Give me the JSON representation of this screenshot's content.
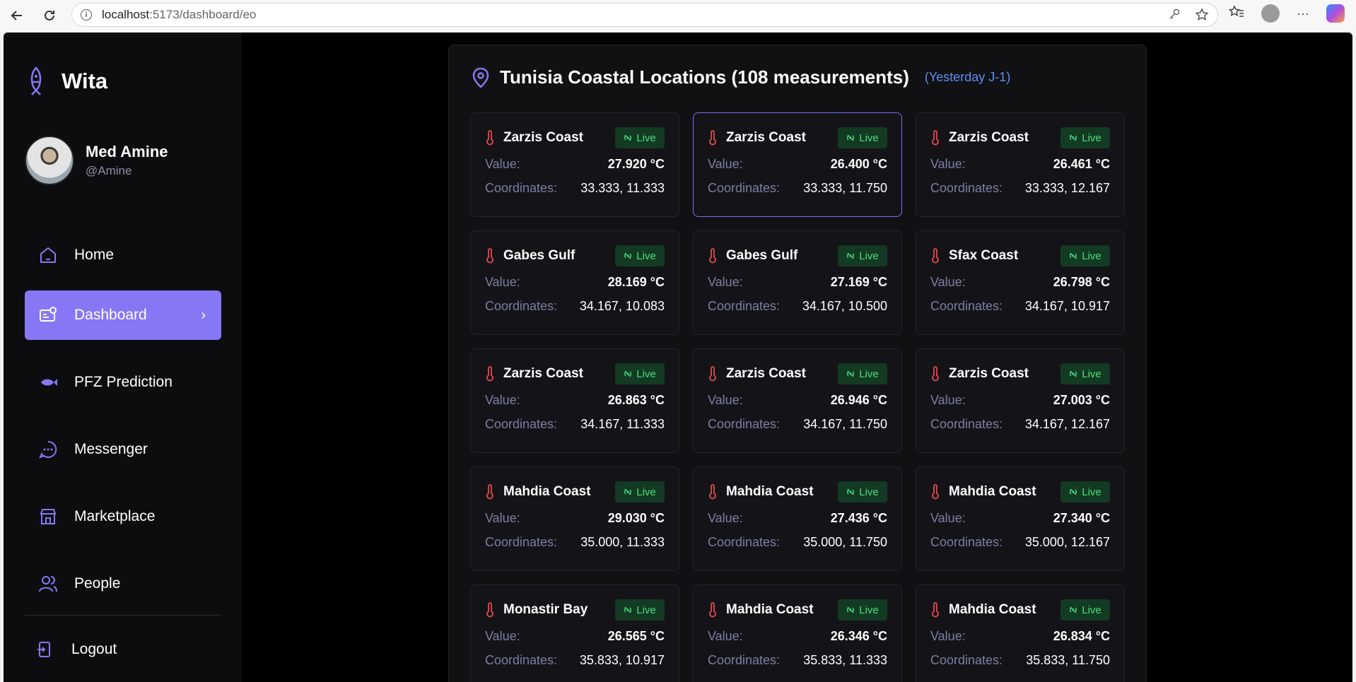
{
  "browser": {
    "url_host": "localhost",
    "url_path": ":5173/dashboard/eo"
  },
  "brand": {
    "name": "Wita"
  },
  "user": {
    "name": "Med Amine",
    "handle": "@Amine"
  },
  "menu": [
    {
      "label": "Home",
      "icon": "home-icon",
      "active": false
    },
    {
      "label": "Dashboard",
      "icon": "dashboard-icon",
      "active": true
    },
    {
      "label": "PFZ Prediction",
      "icon": "fish-icon",
      "active": false
    },
    {
      "label": "Messenger",
      "icon": "chat-icon",
      "active": false
    },
    {
      "label": "Marketplace",
      "icon": "store-icon",
      "active": false
    },
    {
      "label": "People",
      "icon": "people-icon",
      "active": false
    }
  ],
  "logout_label": "Logout",
  "panel": {
    "title": "Tunisia Coastal Locations (108 measurements)",
    "subtitle": "(Yesterday J-1)",
    "value_label": "Value:",
    "coords_label": "Coordinates:",
    "live_label": "Live"
  },
  "cards": [
    {
      "name": "Zarzis Coast",
      "value": "27.920 °C",
      "coords": "33.333, 11.333",
      "selected": false
    },
    {
      "name": "Zarzis Coast",
      "value": "26.400 °C",
      "coords": "33.333, 11.750",
      "selected": true
    },
    {
      "name": "Zarzis Coast",
      "value": "26.461 °C",
      "coords": "33.333, 12.167",
      "selected": false
    },
    {
      "name": "Gabes Gulf",
      "value": "28.169 °C",
      "coords": "34.167, 10.083",
      "selected": false
    },
    {
      "name": "Gabes Gulf",
      "value": "27.169 °C",
      "coords": "34.167, 10.500",
      "selected": false
    },
    {
      "name": "Sfax Coast",
      "value": "26.798 °C",
      "coords": "34.167, 10.917",
      "selected": false
    },
    {
      "name": "Zarzis Coast",
      "value": "26.863 °C",
      "coords": "34.167, 11.333",
      "selected": false
    },
    {
      "name": "Zarzis Coast",
      "value": "26.946 °C",
      "coords": "34.167, 11.750",
      "selected": false
    },
    {
      "name": "Zarzis Coast",
      "value": "27.003 °C",
      "coords": "34.167, 12.167",
      "selected": false
    },
    {
      "name": "Mahdia Coast",
      "value": "29.030 °C",
      "coords": "35.000, 11.333",
      "selected": false
    },
    {
      "name": "Mahdia Coast",
      "value": "27.436 °C",
      "coords": "35.000, 11.750",
      "selected": false
    },
    {
      "name": "Mahdia Coast",
      "value": "27.340 °C",
      "coords": "35.000, 12.167",
      "selected": false
    },
    {
      "name": "Monastir Bay",
      "value": "26.565 °C",
      "coords": "35.833, 10.917",
      "selected": false
    },
    {
      "name": "Mahdia Coast",
      "value": "26.346 °C",
      "coords": "35.833, 11.333",
      "selected": false
    },
    {
      "name": "Mahdia Coast",
      "value": "26.834 °C",
      "coords": "35.833, 11.750",
      "selected": false
    }
  ],
  "colors": {
    "accent": "#8678f4",
    "live_bg": "#133a22",
    "live_text": "#4ade80",
    "thermometer": "#e5484d",
    "subtitle": "#5f8df5"
  }
}
